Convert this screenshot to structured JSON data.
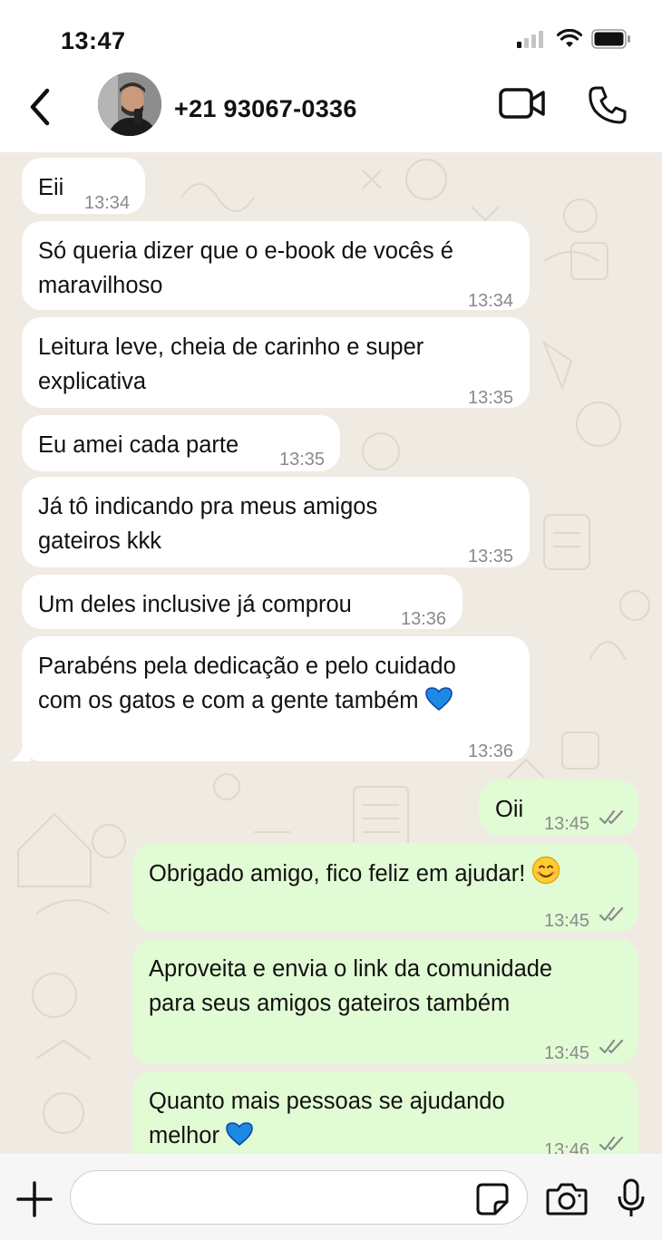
{
  "status_bar": {
    "time": "13:47"
  },
  "header": {
    "contact_name": "+21 93067-0336"
  },
  "messages": [
    {
      "direction": "in",
      "text": "Eii",
      "time": "13:34"
    },
    {
      "direction": "in",
      "text": "Só queria dizer que o e-book de vocês é\nmaravilhoso",
      "time": "13:34"
    },
    {
      "direction": "in",
      "text": "Leitura leve, cheia de carinho e super\nexplicativa",
      "time": "13:35"
    },
    {
      "direction": "in",
      "text": "Eu amei cada parte",
      "time": "13:35"
    },
    {
      "direction": "in",
      "text": "Já tô indicando pra meus amigos\ngateiros kkk",
      "time": "13:35"
    },
    {
      "direction": "in",
      "text": "Um deles inclusive já comprou",
      "time": "13:36"
    },
    {
      "direction": "in",
      "text": "Parabéns pela dedicação e pelo cuidado\ncom os gatos e com a gente também",
      "emoji": "blue-heart",
      "time": "13:36"
    },
    {
      "direction": "out",
      "text": "Oii",
      "time": "13:45",
      "status": "read"
    },
    {
      "direction": "out",
      "text": "Obrigado amigo, fico feliz em ajudar!",
      "emoji": "smiling-face",
      "time": "13:45",
      "status": "read"
    },
    {
      "direction": "out",
      "text": "Aproveita e envia o link da comunidade\npara seus amigos gateiros também",
      "time": "13:45",
      "status": "read"
    },
    {
      "direction": "out",
      "text": "Quanto mais pessoas se ajudando\nmelhor",
      "emoji": "blue-heart",
      "time": "13:46",
      "status": "read"
    }
  ],
  "composer": {
    "placeholder": ""
  },
  "colors": {
    "incoming": "#ffffff",
    "outgoing": "#e1fbd4",
    "background": "#efeae2",
    "ticks": "#8a8a8a",
    "blue_heart": "#1e88e5"
  }
}
